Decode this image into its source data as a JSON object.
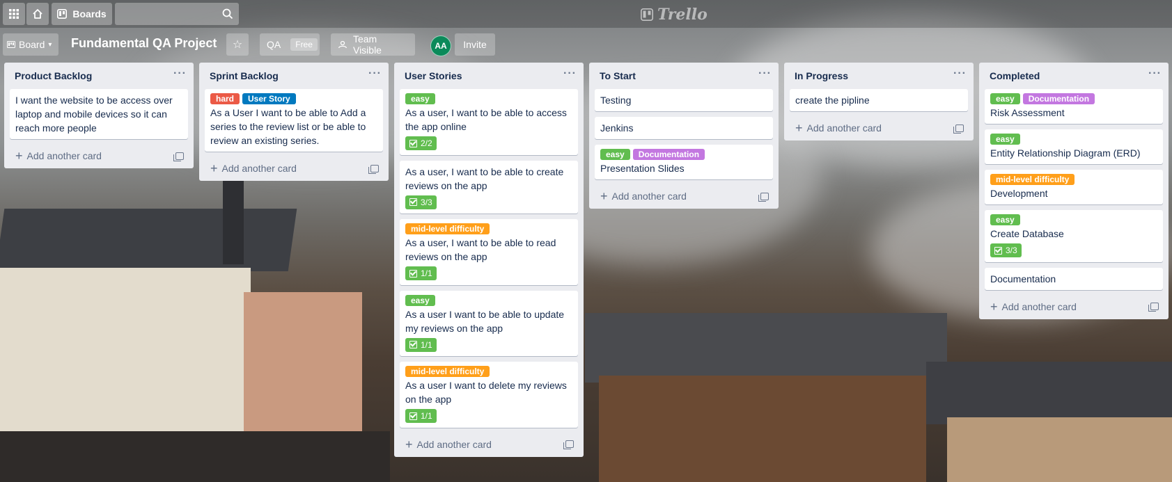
{
  "colors": {
    "green": "#61bd4f",
    "red": "#eb5a46",
    "blue": "#0079bf",
    "purple": "#c377e0",
    "orange": "#ff9f1a",
    "avatar": "#0b8a5a"
  },
  "topbar": {
    "boards_label": "Boards",
    "logo_text": "Trello"
  },
  "board": {
    "view_label": "Board",
    "title": "Fundamental QA Project",
    "team_label": "QA",
    "plan_label": "Free",
    "visibility_label": "Team Visible",
    "avatar_initials": "AA",
    "invite_label": "Invite"
  },
  "add_card_label": "Add another card",
  "lists": [
    {
      "title": "Product Backlog",
      "cards": [
        {
          "labels": [],
          "text": "I want the website to be access over laptop and mobile devices so it can reach more people",
          "badge": null
        }
      ]
    },
    {
      "title": "Sprint Backlog",
      "cards": [
        {
          "labels": [
            {
              "text": "hard",
              "color": "red"
            },
            {
              "text": "User Story",
              "color": "blue"
            }
          ],
          "text": "As a User I want to be able to Add a series to the review list or be able to review an existing series.",
          "badge": null
        }
      ]
    },
    {
      "title": "User Stories",
      "cards": [
        {
          "labels": [
            {
              "text": "easy",
              "color": "green"
            }
          ],
          "text": "As a user, I want to be able to access the app online",
          "badge": "2/2"
        },
        {
          "labels": [],
          "text": "As a user, I want to be able to create reviews on the app",
          "badge": "3/3"
        },
        {
          "labels": [
            {
              "text": "mid-level difficulty",
              "color": "orange"
            }
          ],
          "text": "As a user, I want to be able to read reviews on the app",
          "badge": "1/1"
        },
        {
          "labels": [
            {
              "text": "easy",
              "color": "green"
            }
          ],
          "text": "As a user I want to be able to update my reviews on the app",
          "badge": "1/1"
        },
        {
          "labels": [
            {
              "text": "mid-level difficulty",
              "color": "orange"
            }
          ],
          "text": "As a user I want to delete my reviews on the app",
          "badge": "1/1"
        }
      ]
    },
    {
      "title": "To Start",
      "cards": [
        {
          "labels": [],
          "text": "Testing",
          "badge": null
        },
        {
          "labels": [],
          "text": "Jenkins",
          "badge": null
        },
        {
          "labels": [
            {
              "text": "easy",
              "color": "green"
            },
            {
              "text": "Documentation",
              "color": "purple"
            }
          ],
          "text": "Presentation Slides",
          "badge": null
        }
      ]
    },
    {
      "title": "In Progress",
      "cards": [
        {
          "labels": [],
          "text": "create the pipline",
          "badge": null
        }
      ]
    },
    {
      "title": "Completed",
      "cards": [
        {
          "labels": [
            {
              "text": "easy",
              "color": "green"
            },
            {
              "text": "Documentation",
              "color": "purple"
            }
          ],
          "text": "Risk Assessment",
          "badge": null
        },
        {
          "labels": [
            {
              "text": "easy",
              "color": "green"
            }
          ],
          "text": "Entity Relationship Diagram (ERD)",
          "badge": null
        },
        {
          "labels": [
            {
              "text": "mid-level difficulty",
              "color": "orange"
            }
          ],
          "text": "Development",
          "badge": null
        },
        {
          "labels": [
            {
              "text": "easy",
              "color": "green"
            }
          ],
          "text": "Create Database",
          "badge": "3/3"
        },
        {
          "labels": [],
          "text": "Documentation",
          "badge": null
        }
      ]
    }
  ]
}
